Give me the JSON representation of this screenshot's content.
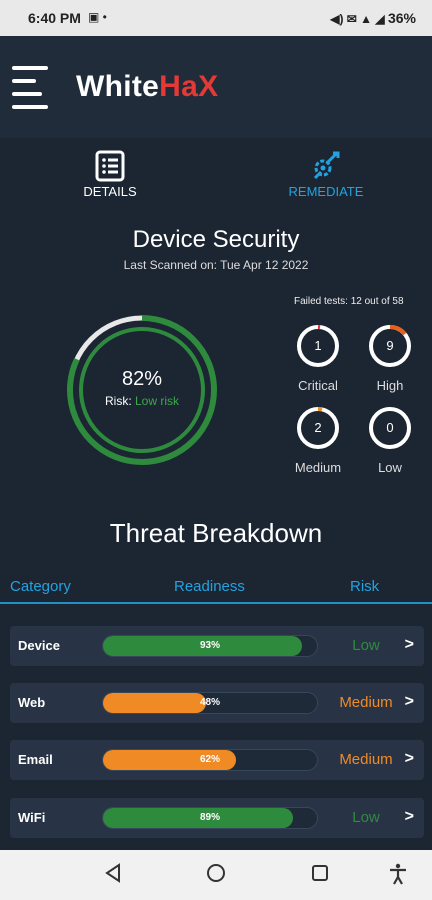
{
  "status_bar": {
    "time": "6:40 PM",
    "left_icons": "▣ •",
    "right_icons": "◀) ✉ ▲ ◢",
    "battery": "36%"
  },
  "header": {
    "logo_white": "White",
    "logo_red": "HaX"
  },
  "tabs": {
    "details_label": "DETAILS",
    "remediate_label": "REMEDIATE"
  },
  "security": {
    "title": "Device Security",
    "last_scanned": "Last Scanned on: Tue Apr 12 2022",
    "readiness_percent": 82,
    "percent_label": "82%",
    "risk_prefix": "Risk:",
    "risk_value": "Low risk",
    "failed_tests": "Failed tests: 12 out of 58",
    "counts": [
      {
        "label": "Critical",
        "value": "1"
      },
      {
        "label": "High",
        "value": "9"
      },
      {
        "label": "Medium",
        "value": "2"
      },
      {
        "label": "Low",
        "value": "0"
      }
    ]
  },
  "threat": {
    "title": "Threat Breakdown",
    "columns": {
      "category": "Category",
      "readiness": "Readiness",
      "risk": "Risk"
    },
    "rows": [
      {
        "category": "Device",
        "readiness": 93,
        "readiness_label": "93%",
        "risk": "Low",
        "bar_color": "#2e8b3e",
        "risk_color": "#2e8b3e"
      },
      {
        "category": "Web",
        "readiness": 48,
        "readiness_label": "48%",
        "risk": "Medium",
        "bar_color": "#f08a24",
        "risk_color": "#f08a24"
      },
      {
        "category": "Email",
        "readiness": 62,
        "readiness_label": "62%",
        "risk": "Medium",
        "bar_color": "#f08a24",
        "risk_color": "#f08a24"
      },
      {
        "category": "WiFi",
        "readiness": 89,
        "readiness_label": "89%",
        "risk": "Low",
        "bar_color": "#2e8b3e",
        "risk_color": "#2e8b3e"
      }
    ],
    "chevron": ">"
  },
  "colors": {
    "accent_blue": "#22a3e0",
    "brand_red": "#e53935",
    "low_green": "#2e8b3e",
    "medium_orange": "#f08a24",
    "high_orange": "#e8611a"
  },
  "icons": {
    "details": "list-document-icon",
    "remediate": "wrench-gear-icon",
    "nav_back": "back-triangle-icon",
    "nav_home": "home-circle-icon",
    "nav_recents": "recents-square-icon",
    "nav_accessibility": "accessibility-icon"
  }
}
